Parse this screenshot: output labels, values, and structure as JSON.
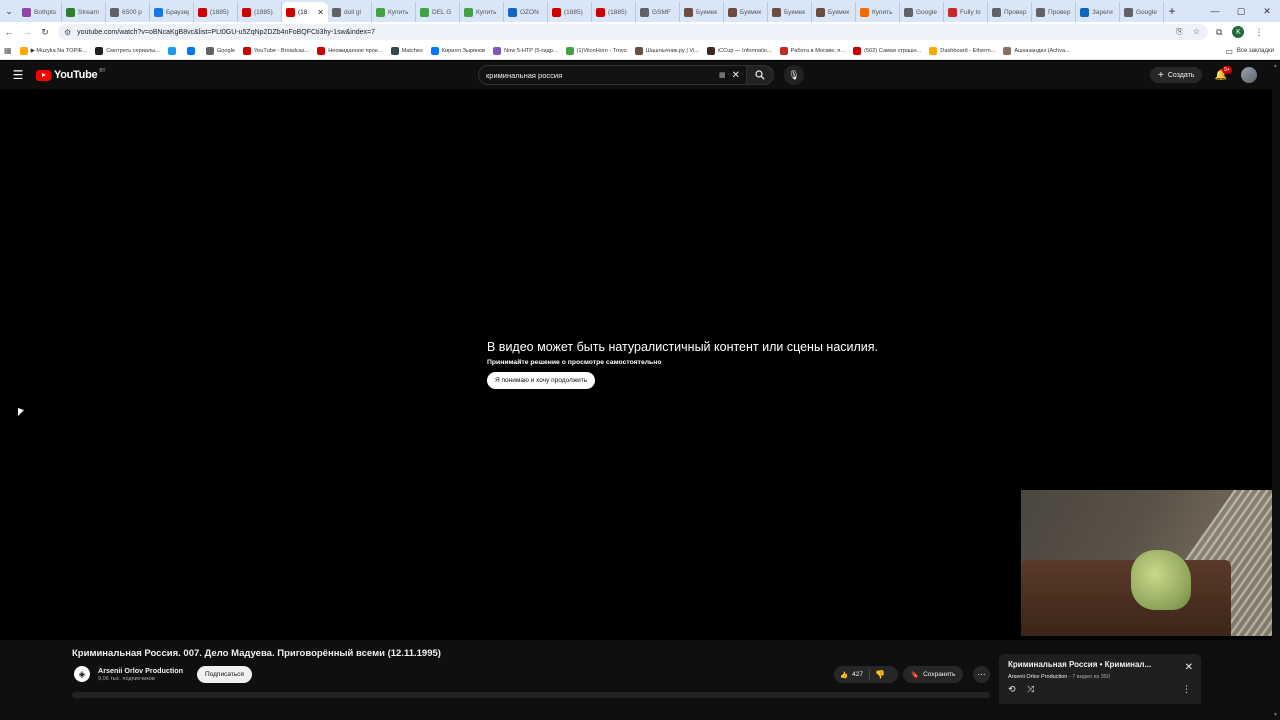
{
  "browser": {
    "tabs": [
      {
        "title": "Bothpts",
        "color": "#8e44ad",
        "active": false
      },
      {
        "title": "Stream",
        "color": "#2e7d32",
        "active": false
      },
      {
        "title": "6500 р",
        "color": "#5f6368",
        "active": false
      },
      {
        "title": "Браузер",
        "color": "#1a73e8",
        "active": false
      },
      {
        "title": "(1885)",
        "color": "#cc0000",
        "active": false
      },
      {
        "title": "(1885)",
        "color": "#cc0000",
        "active": false
      },
      {
        "title": "(18",
        "color": "#cc0000",
        "active": true
      },
      {
        "title": "doll gl",
        "color": "#5f6368",
        "active": false
      },
      {
        "title": "Купить",
        "color": "#43a047",
        "active": false
      },
      {
        "title": "DEL G",
        "color": "#43a047",
        "active": false
      },
      {
        "title": "Купить",
        "color": "#43a047",
        "active": false
      },
      {
        "title": "OZON",
        "color": "#1565c0",
        "active": false
      },
      {
        "title": "(1885)",
        "color": "#cc0000",
        "active": false
      },
      {
        "title": "(1885)",
        "color": "#cc0000",
        "active": false
      },
      {
        "title": "GSMF",
        "color": "#5f6368",
        "active": false
      },
      {
        "title": "Букмек",
        "color": "#6d4c41",
        "active": false
      },
      {
        "title": "Букмек",
        "color": "#6d4c41",
        "active": false
      },
      {
        "title": "Букмек",
        "color": "#6d4c41",
        "active": false
      },
      {
        "title": "Букмек",
        "color": "#6d4c41",
        "active": false
      },
      {
        "title": "Купить",
        "color": "#ef6c00",
        "active": false
      },
      {
        "title": "Google",
        "color": "#5f6368",
        "active": false
      },
      {
        "title": "Fully lo",
        "color": "#c62828",
        "active": false
      },
      {
        "title": "Провер",
        "color": "#5f6368",
        "active": false
      },
      {
        "title": "Провер",
        "color": "#5f6368",
        "active": false
      },
      {
        "title": "Зареги",
        "color": "#1565c0",
        "active": false
      },
      {
        "title": "Google",
        "color": "#5f6368",
        "active": false
      }
    ],
    "url": "youtube.com/watch?v=oBNcaKgB8vc&list=PLt0GU-u5ZqNp2DZb4nFoBQFCti3hy-1sw&index=7",
    "profile_letter": "K",
    "bookmarks": [
      {
        "label": "▶ Muzyka Na TOPIE...",
        "color": "#f9ab00"
      },
      {
        "label": "Смотреть сериалы...",
        "color": "#202124"
      },
      {
        "label": "",
        "color": "#1d9bf0"
      },
      {
        "label": "",
        "color": "#0077ff"
      },
      {
        "label": "Google",
        "color": "#5f6368"
      },
      {
        "label": "YouTube - Broadcas...",
        "color": "#cc0000"
      },
      {
        "label": "Неожиданное прое...",
        "color": "#cc0000"
      },
      {
        "label": "Matches",
        "color": "#37474f"
      },
      {
        "label": "Кирилл Зырянов",
        "color": "#0077ff"
      },
      {
        "label": "Now 5-HTP (5-гидр...",
        "color": "#7e57c2"
      },
      {
        "label": "(1)VilonHoro - Trovo",
        "color": "#43a047"
      },
      {
        "label": "Шашлычник.ру | Vi...",
        "color": "#6d4c41"
      },
      {
        "label": "iCCup — Informatio...",
        "color": "#3e2723"
      },
      {
        "label": "Работа в Москве, п...",
        "color": "#c62828"
      },
      {
        "label": "(562) Самая страшн...",
        "color": "#cc0000"
      },
      {
        "label": "Dashboard - Etherm...",
        "color": "#f9ab00"
      },
      {
        "label": "Ашхазандиз (Aсhva...",
        "color": "#8d6e63"
      }
    ],
    "bookmarks_all": "Все закладки"
  },
  "youtube": {
    "logo_text": "YouTube",
    "logo_region": "BY",
    "search_query": "криминальная россия",
    "create_label": "Создать",
    "notif_badge": "9+"
  },
  "player": {
    "warning_title": "В видео может быть натуралистичный контент или сцены насилия.",
    "warning_sub": "Принимайте решение о просмотре самостоятельно",
    "warning_button": "Я понимаю и хочу продолжить"
  },
  "video": {
    "title": "Криминальная Россия. 007. Дело Мадуева. Приговорённый всеми (12.11.1995)",
    "channel": "Arsenii Orlov Production",
    "subscribers": "9,06 тыс. подписчиков",
    "subscribe_label": "Подписаться",
    "likes": "427",
    "save_label": "Сохранить"
  },
  "playlist": {
    "title": "Криминальная Россия • Криминал...",
    "owner": "Arsenii Orlov Production",
    "position": " - 7 видео из 350"
  }
}
